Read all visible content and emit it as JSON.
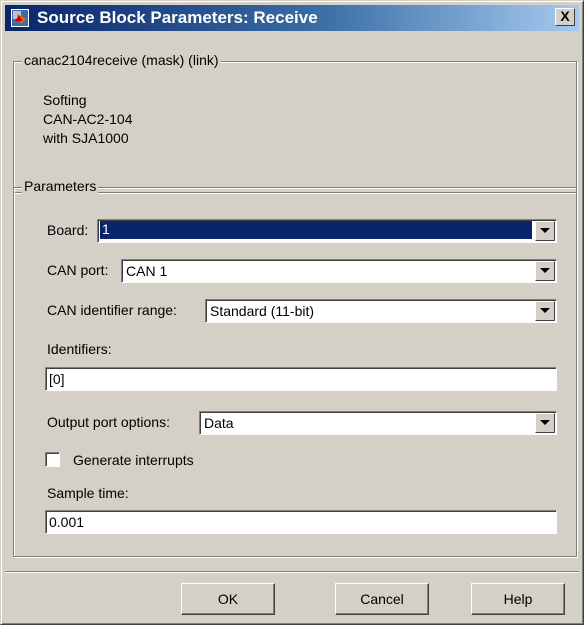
{
  "window": {
    "title": "Source Block Parameters: Receive",
    "close_label": "X"
  },
  "mask": {
    "legend": "canac2104receive (mask) (link)",
    "description_lines": [
      "Softing",
      "CAN-AC2-104",
      "with SJA1000"
    ]
  },
  "parameters": {
    "legend": "Parameters",
    "board": {
      "label": "Board:",
      "value": "1"
    },
    "can_port": {
      "label": "CAN port:",
      "value": "CAN 1"
    },
    "id_range": {
      "label": "CAN identifier range:",
      "value": "Standard (11-bit)"
    },
    "identifiers": {
      "label": "Identifiers:",
      "value": "[0]"
    },
    "output_port": {
      "label": "Output port options:",
      "value": "Data"
    },
    "generate_interrupts": {
      "label": "Generate interrupts",
      "checked": false
    },
    "sample_time": {
      "label": "Sample time:",
      "value": "0.001"
    }
  },
  "buttons": {
    "ok": "OK",
    "cancel": "Cancel",
    "help": "Help"
  },
  "colors": {
    "title_gradient_start": "#0a246a",
    "title_gradient_end": "#a6caf0",
    "dialog_face": "#d4d0c8",
    "selection": "#0a246a"
  },
  "icons": {
    "title": "simulink-block-icon",
    "dropdown": "chevron-down-icon"
  }
}
